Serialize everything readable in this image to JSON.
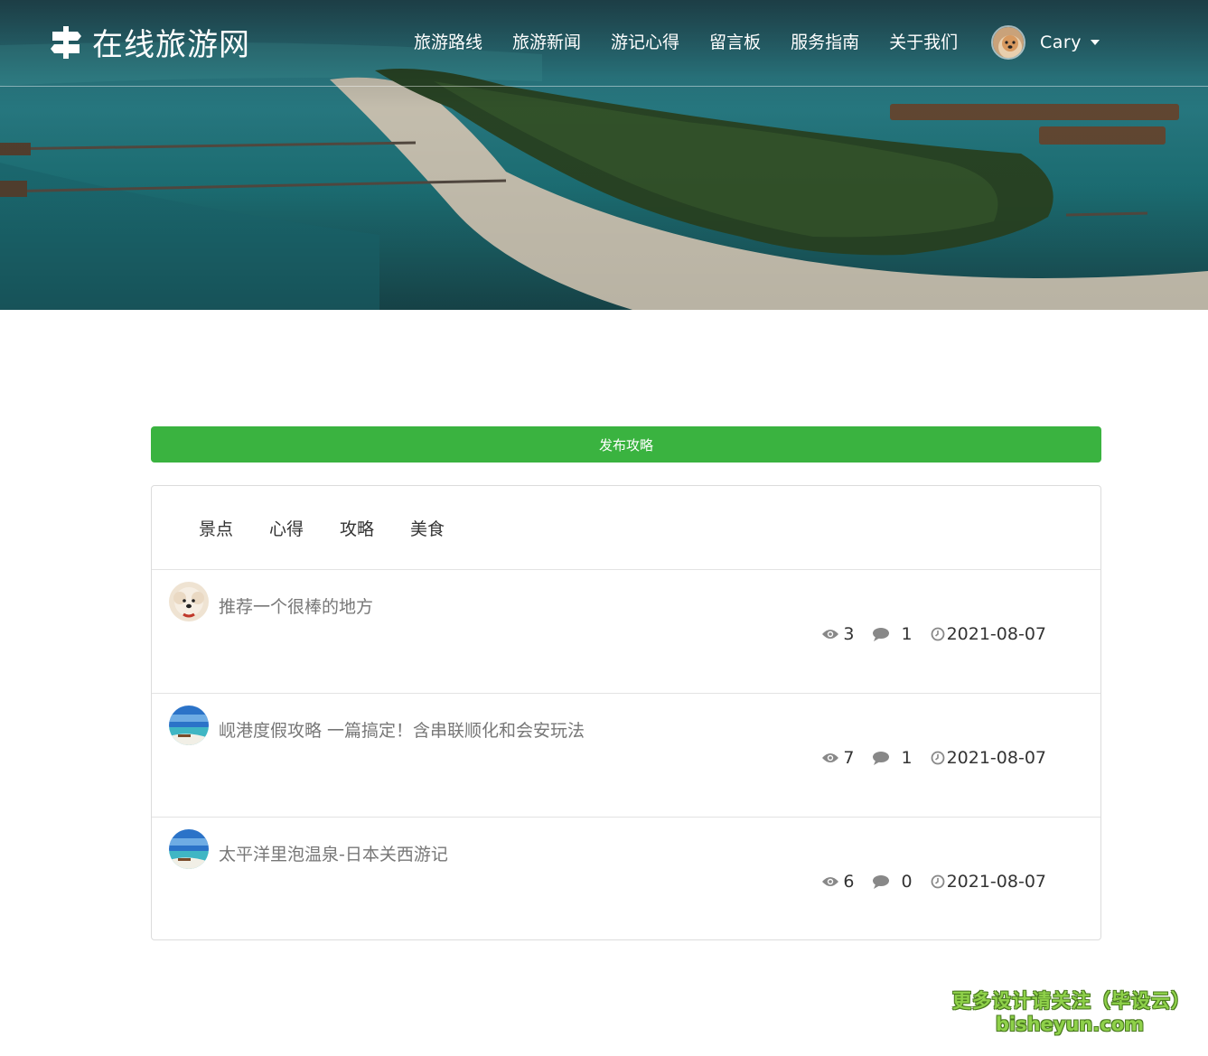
{
  "brand": {
    "title": "在线旅游网"
  },
  "nav": {
    "items": [
      "旅游路线",
      "旅游新闻",
      "游记心得",
      "留言板",
      "服务指南",
      "关于我们"
    ]
  },
  "user": {
    "name": "Cary"
  },
  "publish": {
    "label": "发布攻略"
  },
  "tabs": [
    "景点",
    "心得",
    "攻略",
    "美食"
  ],
  "posts": [
    {
      "title": "推荐一个很棒的地方",
      "views": "3",
      "comments": "1",
      "date": "2021-08-07",
      "avatar": "dog-avatar"
    },
    {
      "title": "岘港度假攻略 一篇搞定！含串联顺化和会安玩法",
      "views": "7",
      "comments": "1",
      "date": "2021-08-07",
      "avatar": "beach-avatar"
    },
    {
      "title": "太平洋里泡温泉-日本关西游记",
      "views": "6",
      "comments": "0",
      "date": "2021-08-07",
      "avatar": "beach-avatar"
    }
  ],
  "watermark": {
    "line1": "更多设计请关注（毕设云）",
    "line2": "bisheyun.com"
  },
  "colors": {
    "accent": "#3ab340",
    "meta_icon": "#888888"
  }
}
